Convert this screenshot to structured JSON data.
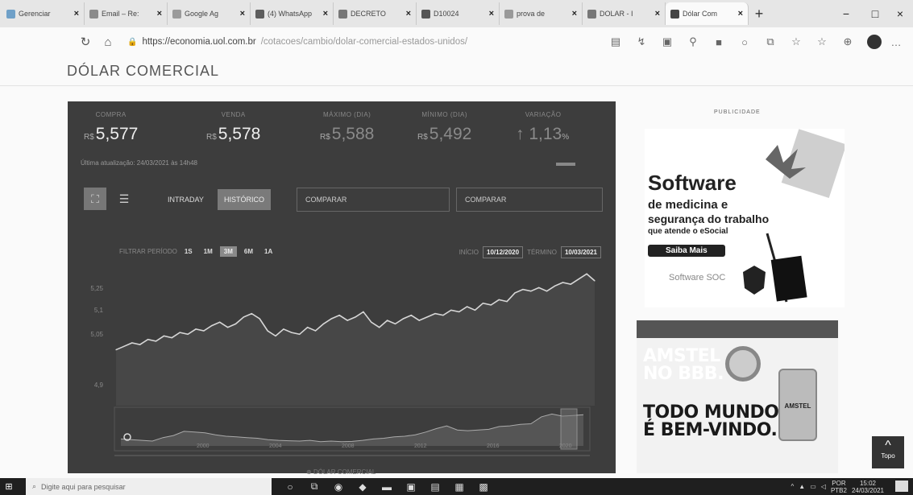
{
  "browser": {
    "tabs": [
      {
        "label": "Gerenciar",
        "fav": "#6fa0c8"
      },
      {
        "label": "Email – Re:",
        "fav": "#8a8a8a"
      },
      {
        "label": "Google Ag",
        "fav": "#9a9a9a"
      },
      {
        "label": "(4) WhatsApp",
        "fav": "#5d5d5d"
      },
      {
        "label": "DECRETO",
        "fav": "#777"
      },
      {
        "label": "D10024",
        "fav": "#555"
      },
      {
        "label": "prova de",
        "fav": "#999"
      },
      {
        "label": "DOLAR - I",
        "fav": "#777"
      },
      {
        "label": "Dólar Com",
        "fav": "#444"
      }
    ],
    "tab_close": "×",
    "new_tab": "+",
    "url_host": "https://economia.uol.com.br",
    "url_path": "/cotacoes/cambio/dolar-comercial-estados-unidos/",
    "window_controls": [
      "−",
      "□",
      "×"
    ]
  },
  "page": {
    "title": "DÓLAR COMERCIAL"
  },
  "quote": {
    "compra": {
      "label": "COMPRA",
      "currency": "R$",
      "value": "5,577"
    },
    "venda": {
      "label": "VENDA",
      "currency": "R$",
      "value": "5,578"
    },
    "maximo": {
      "label": "MÁXIMO (DIA)",
      "currency": "R$",
      "value": "5,588"
    },
    "minimo": {
      "label": "MÍNIMO (DIA)",
      "currency": "R$",
      "value": "5,492"
    },
    "variacao": {
      "label": "VARIAÇÃO",
      "arrow": "↑",
      "value": "1,13",
      "unit": "%"
    },
    "updated": "Última atualização: 24/03/2021 às 14h48"
  },
  "controls": {
    "intraday": "INTRADAY",
    "historico": "HISTÓRICO",
    "compare1": "COMPARAR",
    "compare2": "COMPARAR"
  },
  "period": {
    "label": "FILTRAR PERÍODO",
    "buttons": [
      "1S",
      "1M",
      "3M",
      "6M",
      "1A"
    ],
    "active": "3M",
    "inicio_label": "INÍCIO",
    "inicio": "10/12/2020",
    "termino_label": "TÉRMINO",
    "termino": "10/03/2021"
  },
  "chart_data": {
    "type": "line",
    "y_ticks": [
      "5,25",
      "5,1",
      "5,05",
      "4,9"
    ],
    "series": [
      {
        "values": [
          5.02,
          5.04,
          5.06,
          5.05,
          5.08,
          5.07,
          5.1,
          5.09,
          5.12,
          5.11,
          5.14,
          5.13,
          5.16,
          5.18,
          5.15,
          5.17,
          5.21,
          5.23,
          5.2,
          5.13,
          5.1,
          5.14,
          5.12,
          5.11,
          5.15,
          5.13,
          5.17,
          5.2,
          5.22,
          5.19,
          5.21,
          5.24,
          5.18,
          5.15,
          5.19,
          5.17,
          5.2,
          5.22,
          5.19,
          5.21,
          5.23,
          5.22,
          5.25,
          5.24,
          5.27,
          5.25,
          5.29,
          5.28,
          5.31,
          5.3,
          5.35,
          5.37,
          5.36,
          5.38,
          5.36,
          5.39,
          5.41,
          5.4,
          5.43,
          5.46,
          5.42
        ]
      }
    ],
    "ylim": [
      4.85,
      5.48
    ],
    "navigator": {
      "x_labels": [
        "2000",
        "2004",
        "2008",
        "2012",
        "2016",
        "2020"
      ],
      "values": [
        2.0,
        1.9,
        1.8,
        1.7,
        2.2,
        2.5,
        3.1,
        3.0,
        2.9,
        2.6,
        2.4,
        2.3,
        2.2,
        2.1,
        1.9,
        1.8,
        1.75,
        1.7,
        1.8,
        1.6,
        1.7,
        1.6,
        1.65,
        1.8,
        2.0,
        2.1,
        2.3,
        2.4,
        2.6,
        3.0,
        3.5,
        3.9,
        3.3,
        3.2,
        3.3,
        3.4,
        3.8,
        3.9,
        4.1,
        4.2,
        5.2,
        5.6,
        5.3,
        5.4,
        5.5
      ],
      "ylim": [
        1.0,
        6.0
      ]
    }
  },
  "ads": {
    "publicidade": "PUBLICIDADE",
    "ad1": {
      "headline": "Software",
      "line1": "de medicina e",
      "line2": "segurança do trabalho",
      "line3": "que atende o eSocial",
      "button": "Saiba Mais",
      "brand": "Software SOC"
    },
    "ad2": {
      "line1": "AMSTEL",
      "line2": "NO BBB.",
      "line3": "TODO MUNDO",
      "line4": "É BEM-VINDO.",
      "can": "AMSTEL"
    }
  },
  "topo": {
    "arrow": "^",
    "label": "Topo"
  },
  "footer_label": "DÓLAR COMERCIAL",
  "taskbar": {
    "search_placeholder": "Digite aqui para pesquisar",
    "lang": "POR",
    "lang2": "PTB2",
    "time": "15:02",
    "date": "24/03/2021"
  },
  "colors": {
    "widget_bg": "#3d3d3d",
    "line": "#d6d6d6",
    "area": "#4e4e4e"
  }
}
